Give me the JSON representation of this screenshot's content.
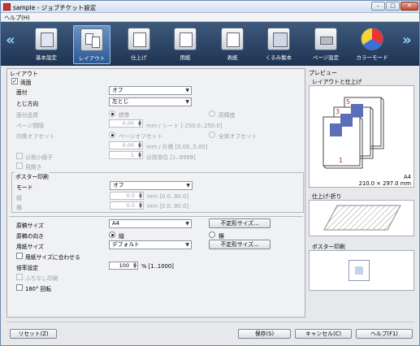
{
  "window": {
    "title": "sample - ジョブチケット設定"
  },
  "menu": {
    "help": "ヘルプ(H)"
  },
  "toolbar": {
    "items": [
      {
        "label": "基本設定",
        "icon": "basic-settings-icon"
      },
      {
        "label": "レイアウト",
        "icon": "layout-icon"
      },
      {
        "label": "仕上げ",
        "icon": "finishing-icon"
      },
      {
        "label": "用紙",
        "icon": "paper-icon"
      },
      {
        "label": "表紙",
        "icon": "cover-icon"
      },
      {
        "label": "くるみ製本",
        "icon": "perfect-binding-icon"
      },
      {
        "label": "ページ設定",
        "icon": "page-settings-icon"
      },
      {
        "label": "カラーモード",
        "icon": "color-mode-icon"
      }
    ],
    "selected": "レイアウト"
  },
  "layout": {
    "section_title": "レイアウト",
    "duplex_label": "両面",
    "duplex_checked": true,
    "pages_per_sheet_label": "面付",
    "pages_per_sheet_value": "オフ",
    "binding_label": "とじ方向",
    "binding_value": "左とじ",
    "imposition_quality_label": "面付品質",
    "quality_standard": "標準",
    "quality_high": "高精度",
    "page_spacing_label": "ページ間隔",
    "page_spacing_value": "0.00",
    "page_spacing_unit": "mm / シート [-250.0..250.0]",
    "inner_offset_label": "内側オフセット",
    "offset_page": "ページオフセット",
    "offset_all": "全体オフセット",
    "offset_value": "0.00",
    "offset_unit": "mm / 片側 [0.00..5.00]",
    "split_label": "分割小冊子",
    "split_value": "1",
    "split_unit": "分割単位 [1..9999]",
    "spread_label": "見開き"
  },
  "poster": {
    "group_title": "ポスター印刷",
    "mode_label": "モード",
    "mode_value": "オフ",
    "vertical_label": "縦",
    "vertical_value": "0.0",
    "vertical_unit": "mm [0.0..90.0]",
    "horizontal_label": "横",
    "horizontal_value": "0.0",
    "horizontal_unit": "mm [0.0..90.0]"
  },
  "paper": {
    "original_size_label": "原稿サイズ",
    "original_size_value": "A4",
    "custom_size_button": "不定形サイズ...",
    "orientation_label": "原稿の向き",
    "orientation_portrait": "縦",
    "orientation_landscape": "横",
    "orientation_selected": "portrait",
    "paper_size_label": "用紙サイズ",
    "paper_size_value": "デフォルト",
    "custom_size_button2": "不定形サイズ...",
    "fit_to_paper_label": "用紙サイズに合わせる",
    "zoom_label": "倍率設定",
    "zoom_value": "100",
    "zoom_unit": "% [1..1000]",
    "borderless_label": "ふちなし印刷",
    "rotate_label": "180° 回転"
  },
  "preview": {
    "title": "プレビュー",
    "layout_finish_title": "レイアウトと仕上げ",
    "paper_name": "A4",
    "paper_dims": "210.0 × 297.0 mm",
    "finish_fold_title": "仕上げ-折り",
    "poster_title": "ポスター印刷",
    "page_numbers": [
      "5",
      "3",
      "1"
    ]
  },
  "footer": {
    "reset": "リセット(Z)",
    "save": "保存(S)",
    "cancel": "キャンセル(C)",
    "help": "ヘルプ(F1)"
  },
  "colors": {
    "toolbar_bg": "#2c4466",
    "selected_tab": "#4f7fb8",
    "arrow": "#8fd4ff",
    "page_number": "#cc2222"
  }
}
